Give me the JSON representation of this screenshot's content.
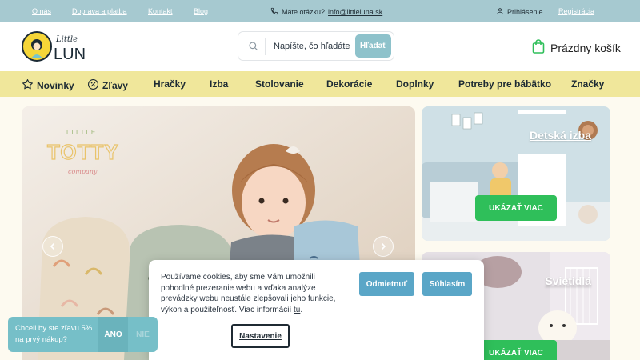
{
  "topbar": {
    "links": [
      "O nás",
      "Doprava a platba",
      "Kontakt",
      "Blog"
    ],
    "question": "Máte otázku?",
    "email": "info@littleluna.sk",
    "login": "Prihlásenie",
    "register": "Registrácia"
  },
  "header": {
    "logo_top": "Little",
    "logo_bottom": "LUNA",
    "search_placeholder": "Napíšte, čo hľadáte",
    "search_button": "Hľadať",
    "cart": "Prázdny košík"
  },
  "nav": {
    "items": [
      "Novinky",
      "Zľavy",
      "Hračky",
      "Izba",
      "Stolovanie",
      "Dekorácie",
      "Doplnky",
      "Potreby pre bábätko",
      "Značky"
    ]
  },
  "hero": {
    "brand_line1": "LITTLE",
    "brand_line2": "TOTTY",
    "brand_line3": "company"
  },
  "cards": [
    {
      "title": "Detská izba",
      "button": "UKÁZAŤ VIAC"
    },
    {
      "title": "Svietidlá",
      "button": "UKÁZAŤ VIAC"
    }
  ],
  "cookie": {
    "text": "Používame cookies, aby sme Vám umožnili pohodlné prezeranie webu a vďaka analýze prevádzky webu neustále zlepšovali jeho funkcie, výkon a použiteľnosť. Viac informácií ",
    "link": "tu",
    "after_link": ".",
    "reject": "Odmietnuť",
    "accept": "Súhlasím",
    "settings": "Nastavenie"
  },
  "discount": {
    "text": "Chceli by ste zľavu 5% na prvý nákup?",
    "yes": "ÁNO",
    "no": "NIE"
  },
  "colors": {
    "topbar": "#a6c9d0",
    "nav": "#f0e79b",
    "accent_green": "#2fbf5a",
    "cookie_button": "#5aa6c7",
    "discount": "#76bfc8"
  }
}
